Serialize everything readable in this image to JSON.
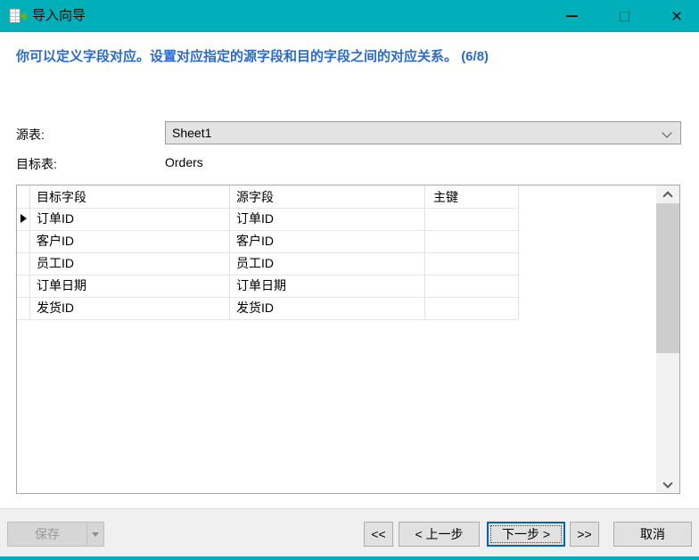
{
  "window": {
    "title": "导入向导"
  },
  "icons": {
    "close_glyph": "×"
  },
  "instruction": {
    "text": "你可以定义字段对应。设置对应指定的源字段和目的字段之间的对应关系。",
    "step": "(6/8)"
  },
  "form": {
    "source_table_label": "源表:",
    "source_table_value": "Sheet1",
    "target_table_label": "目标表:",
    "target_table_value": "Orders"
  },
  "grid": {
    "columns": [
      "目标字段",
      "源字段",
      "主键"
    ],
    "rows": [
      {
        "target": "订单ID",
        "source": "订单ID",
        "pk": "",
        "active": true
      },
      {
        "target": "客户ID",
        "source": "客户ID",
        "pk": ""
      },
      {
        "target": "员工ID",
        "source": "员工ID",
        "pk": ""
      },
      {
        "target": "订单日期",
        "source": "订单日期",
        "pk": ""
      },
      {
        "target": "发货ID",
        "source": "发货ID",
        "pk": ""
      }
    ]
  },
  "footer": {
    "save_label": "保存",
    "first_label": "<<",
    "prev_label": "< 上一步",
    "next_label": "下一步 >",
    "last_label": ">>",
    "cancel_label": "取消"
  },
  "colors": {
    "titlebar_teal": "#00AFBA",
    "instruction_blue": "#2B6BC8",
    "focus_button_border": "#0066B4",
    "grid_line": "#E4E0E0"
  }
}
